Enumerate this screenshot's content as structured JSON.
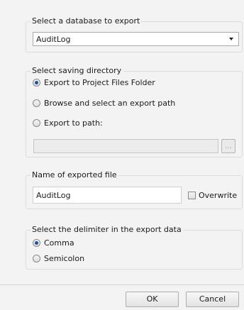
{
  "database_group": {
    "legend": "Select a database to export",
    "selected_database": "AuditLog"
  },
  "directory_group": {
    "legend": "Select saving directory",
    "options": [
      {
        "label": "Export to Project Files Folder",
        "checked": true
      },
      {
        "label": "Browse and select an export path",
        "checked": false
      },
      {
        "label": "Export to path:",
        "checked": false
      }
    ],
    "path_value": "",
    "browse_label": "..."
  },
  "filename_group": {
    "legend": "Name of exported file",
    "file_name": "AuditLog",
    "overwrite_label": "Overwrite",
    "overwrite_checked": false
  },
  "delimiter_group": {
    "legend": "Select the delimiter in the export data",
    "options": [
      {
        "label": "Comma",
        "checked": true
      },
      {
        "label": "Semicolon",
        "checked": false
      }
    ]
  },
  "buttons": {
    "ok_label": "OK",
    "cancel_label": "Cancel"
  }
}
